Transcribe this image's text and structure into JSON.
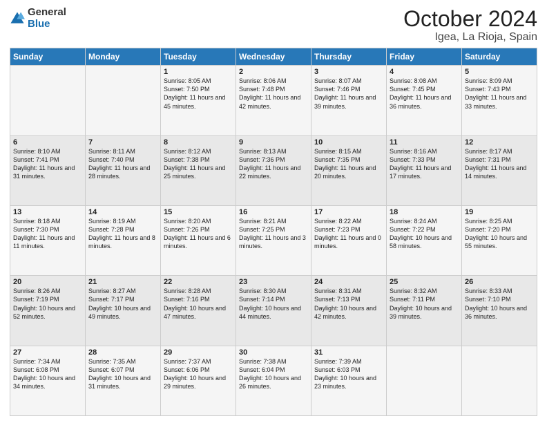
{
  "header": {
    "logo_general": "General",
    "logo_blue": "Blue",
    "title": "October 2024",
    "subtitle": "Igea, La Rioja, Spain"
  },
  "columns": [
    "Sunday",
    "Monday",
    "Tuesday",
    "Wednesday",
    "Thursday",
    "Friday",
    "Saturday"
  ],
  "weeks": [
    [
      {
        "day": "",
        "sunrise": "",
        "sunset": "",
        "daylight": ""
      },
      {
        "day": "",
        "sunrise": "",
        "sunset": "",
        "daylight": ""
      },
      {
        "day": "1",
        "sunrise": "Sunrise: 8:05 AM",
        "sunset": "Sunset: 7:50 PM",
        "daylight": "Daylight: 11 hours and 45 minutes."
      },
      {
        "day": "2",
        "sunrise": "Sunrise: 8:06 AM",
        "sunset": "Sunset: 7:48 PM",
        "daylight": "Daylight: 11 hours and 42 minutes."
      },
      {
        "day": "3",
        "sunrise": "Sunrise: 8:07 AM",
        "sunset": "Sunset: 7:46 PM",
        "daylight": "Daylight: 11 hours and 39 minutes."
      },
      {
        "day": "4",
        "sunrise": "Sunrise: 8:08 AM",
        "sunset": "Sunset: 7:45 PM",
        "daylight": "Daylight: 11 hours and 36 minutes."
      },
      {
        "day": "5",
        "sunrise": "Sunrise: 8:09 AM",
        "sunset": "Sunset: 7:43 PM",
        "daylight": "Daylight: 11 hours and 33 minutes."
      }
    ],
    [
      {
        "day": "6",
        "sunrise": "Sunrise: 8:10 AM",
        "sunset": "Sunset: 7:41 PM",
        "daylight": "Daylight: 11 hours and 31 minutes."
      },
      {
        "day": "7",
        "sunrise": "Sunrise: 8:11 AM",
        "sunset": "Sunset: 7:40 PM",
        "daylight": "Daylight: 11 hours and 28 minutes."
      },
      {
        "day": "8",
        "sunrise": "Sunrise: 8:12 AM",
        "sunset": "Sunset: 7:38 PM",
        "daylight": "Daylight: 11 hours and 25 minutes."
      },
      {
        "day": "9",
        "sunrise": "Sunrise: 8:13 AM",
        "sunset": "Sunset: 7:36 PM",
        "daylight": "Daylight: 11 hours and 22 minutes."
      },
      {
        "day": "10",
        "sunrise": "Sunrise: 8:15 AM",
        "sunset": "Sunset: 7:35 PM",
        "daylight": "Daylight: 11 hours and 20 minutes."
      },
      {
        "day": "11",
        "sunrise": "Sunrise: 8:16 AM",
        "sunset": "Sunset: 7:33 PM",
        "daylight": "Daylight: 11 hours and 17 minutes."
      },
      {
        "day": "12",
        "sunrise": "Sunrise: 8:17 AM",
        "sunset": "Sunset: 7:31 PM",
        "daylight": "Daylight: 11 hours and 14 minutes."
      }
    ],
    [
      {
        "day": "13",
        "sunrise": "Sunrise: 8:18 AM",
        "sunset": "Sunset: 7:30 PM",
        "daylight": "Daylight: 11 hours and 11 minutes."
      },
      {
        "day": "14",
        "sunrise": "Sunrise: 8:19 AM",
        "sunset": "Sunset: 7:28 PM",
        "daylight": "Daylight: 11 hours and 8 minutes."
      },
      {
        "day": "15",
        "sunrise": "Sunrise: 8:20 AM",
        "sunset": "Sunset: 7:26 PM",
        "daylight": "Daylight: 11 hours and 6 minutes."
      },
      {
        "day": "16",
        "sunrise": "Sunrise: 8:21 AM",
        "sunset": "Sunset: 7:25 PM",
        "daylight": "Daylight: 11 hours and 3 minutes."
      },
      {
        "day": "17",
        "sunrise": "Sunrise: 8:22 AM",
        "sunset": "Sunset: 7:23 PM",
        "daylight": "Daylight: 11 hours and 0 minutes."
      },
      {
        "day": "18",
        "sunrise": "Sunrise: 8:24 AM",
        "sunset": "Sunset: 7:22 PM",
        "daylight": "Daylight: 10 hours and 58 minutes."
      },
      {
        "day": "19",
        "sunrise": "Sunrise: 8:25 AM",
        "sunset": "Sunset: 7:20 PM",
        "daylight": "Daylight: 10 hours and 55 minutes."
      }
    ],
    [
      {
        "day": "20",
        "sunrise": "Sunrise: 8:26 AM",
        "sunset": "Sunset: 7:19 PM",
        "daylight": "Daylight: 10 hours and 52 minutes."
      },
      {
        "day": "21",
        "sunrise": "Sunrise: 8:27 AM",
        "sunset": "Sunset: 7:17 PM",
        "daylight": "Daylight: 10 hours and 49 minutes."
      },
      {
        "day": "22",
        "sunrise": "Sunrise: 8:28 AM",
        "sunset": "Sunset: 7:16 PM",
        "daylight": "Daylight: 10 hours and 47 minutes."
      },
      {
        "day": "23",
        "sunrise": "Sunrise: 8:30 AM",
        "sunset": "Sunset: 7:14 PM",
        "daylight": "Daylight: 10 hours and 44 minutes."
      },
      {
        "day": "24",
        "sunrise": "Sunrise: 8:31 AM",
        "sunset": "Sunset: 7:13 PM",
        "daylight": "Daylight: 10 hours and 42 minutes."
      },
      {
        "day": "25",
        "sunrise": "Sunrise: 8:32 AM",
        "sunset": "Sunset: 7:11 PM",
        "daylight": "Daylight: 10 hours and 39 minutes."
      },
      {
        "day": "26",
        "sunrise": "Sunrise: 8:33 AM",
        "sunset": "Sunset: 7:10 PM",
        "daylight": "Daylight: 10 hours and 36 minutes."
      }
    ],
    [
      {
        "day": "27",
        "sunrise": "Sunrise: 7:34 AM",
        "sunset": "Sunset: 6:08 PM",
        "daylight": "Daylight: 10 hours and 34 minutes."
      },
      {
        "day": "28",
        "sunrise": "Sunrise: 7:35 AM",
        "sunset": "Sunset: 6:07 PM",
        "daylight": "Daylight: 10 hours and 31 minutes."
      },
      {
        "day": "29",
        "sunrise": "Sunrise: 7:37 AM",
        "sunset": "Sunset: 6:06 PM",
        "daylight": "Daylight: 10 hours and 29 minutes."
      },
      {
        "day": "30",
        "sunrise": "Sunrise: 7:38 AM",
        "sunset": "Sunset: 6:04 PM",
        "daylight": "Daylight: 10 hours and 26 minutes."
      },
      {
        "day": "31",
        "sunrise": "Sunrise: 7:39 AM",
        "sunset": "Sunset: 6:03 PM",
        "daylight": "Daylight: 10 hours and 23 minutes."
      },
      {
        "day": "",
        "sunrise": "",
        "sunset": "",
        "daylight": ""
      },
      {
        "day": "",
        "sunrise": "",
        "sunset": "",
        "daylight": ""
      }
    ]
  ]
}
